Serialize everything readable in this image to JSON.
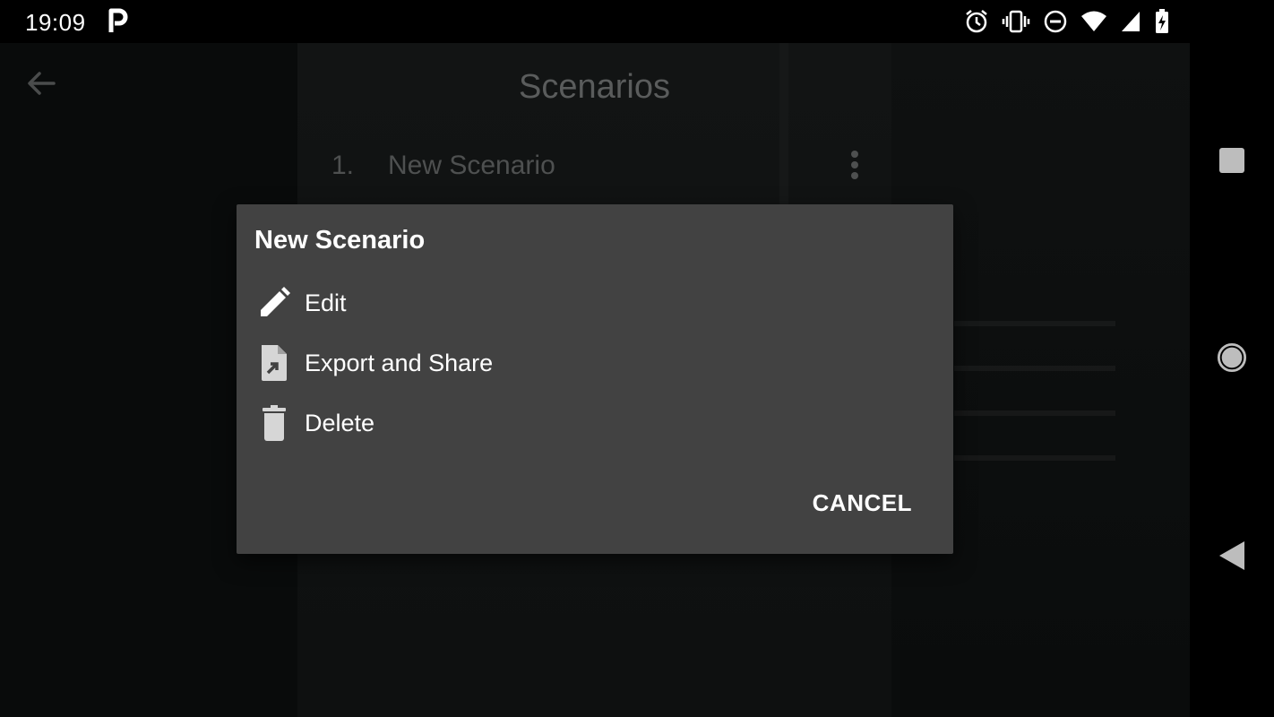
{
  "status_bar": {
    "time": "19:09",
    "icons": [
      "p-icon",
      "alarm-icon",
      "vibrate-icon",
      "do-not-disturb-icon",
      "wifi-icon",
      "cell-signal-icon",
      "battery-charging-icon"
    ]
  },
  "app": {
    "title": "Scenarios",
    "list": [
      {
        "number": "1.",
        "label": "New Scenario"
      }
    ]
  },
  "dialog": {
    "title": "New Scenario",
    "items": [
      {
        "label": "Edit",
        "icon": "pencil-icon"
      },
      {
        "label": "Export and Share",
        "icon": "file-export-icon"
      },
      {
        "label": "Delete",
        "icon": "trash-icon"
      }
    ],
    "cancel_label": "CANCEL"
  },
  "nav_bar": {
    "buttons": [
      "recents-square-icon",
      "home-circle-icon",
      "back-triangle-icon"
    ]
  },
  "colors": {
    "dialog_bg": "#424242",
    "scrim": "#0b0d0d",
    "text_primary": "#ffffff",
    "text_dimmed": "#5a5c5c"
  }
}
